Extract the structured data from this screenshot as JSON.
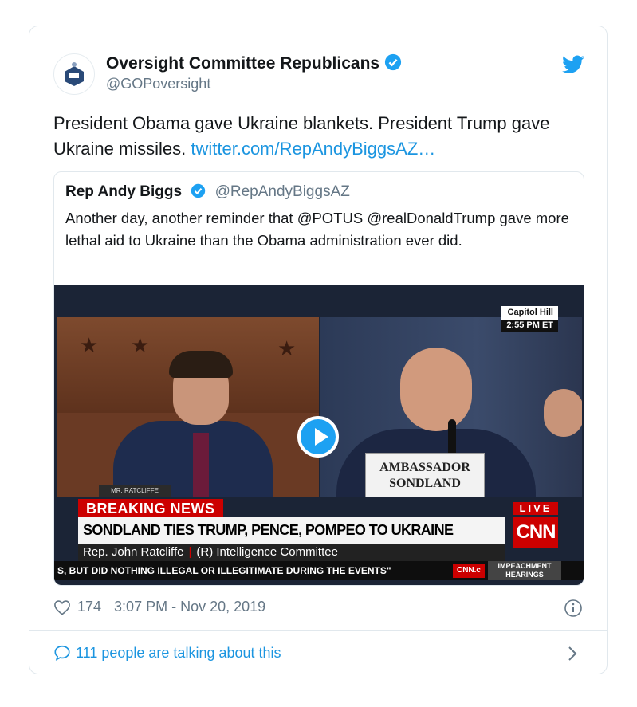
{
  "tweet": {
    "author_name": "Oversight Committee Republicans",
    "handle": "@GOPoversight",
    "avatar_icon": "capitol-seal-icon",
    "text": "President Obama gave Ukraine blankets. President Trump gave Ukraine missiles. ",
    "link_text": "twitter.com/RepAndyBiggsAZ…",
    "likes": "174",
    "timestamp": "3:07 PM - Nov 20, 2019",
    "talking": "111 people are talking about this"
  },
  "quoted": {
    "author_name": "Rep Andy Biggs",
    "handle": "@RepAndyBiggsAZ",
    "text": "Another day, another reminder that @POTUS @realDonaldTrump gave more lethal aid to Ukraine than the Obama administration ever did."
  },
  "video": {
    "location": "Capitol Hill",
    "time": "2:55 PM ET",
    "nameplate_left": "MR. RATCLIFFE",
    "nameplate_right_1": "AMBASSADOR",
    "nameplate_right_2": "SONDLAND",
    "breaking": "BREAKING NEWS",
    "headline": "SONDLAND TIES TRUMP, PENCE, POMPEO TO UKRAINE PRESSURE CAMPAIGN",
    "speaker": "Rep. John Ratcliffe",
    "speaker_role": "(R) Intelligence Committee",
    "ticker": "S, BUT DID NOTHING ILLEGAL OR ILLEGITIMATE DURING THE EVENTS\"",
    "live": "LIVE",
    "network": "CNN",
    "network_small": "CNN.c",
    "impeachment": "IMPEACHMENT HEARINGS"
  },
  "colors": {
    "twitter_blue": "#1da1f2",
    "link": "#1b95e0",
    "cnn_red": "#cc0000"
  }
}
